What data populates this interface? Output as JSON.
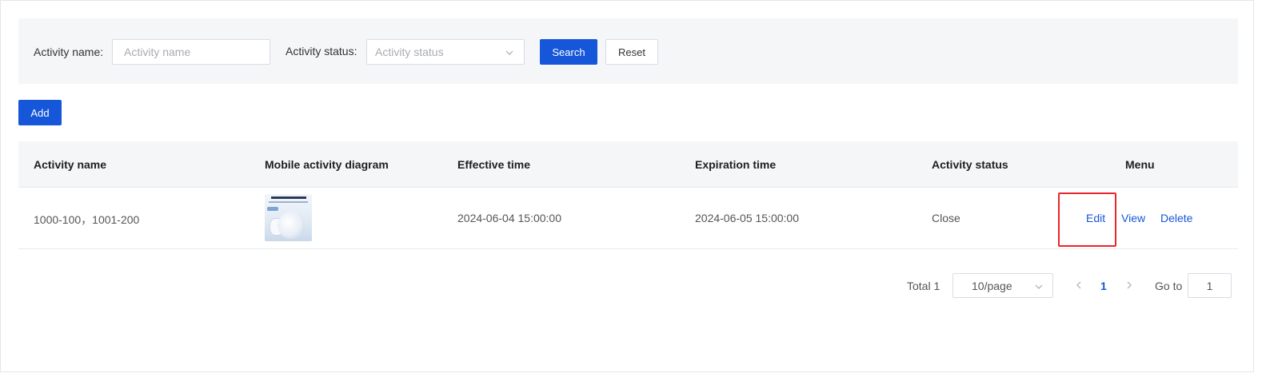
{
  "filters": {
    "name_label": "Activity name:",
    "name_placeholder": "Activity name",
    "status_label": "Activity status:",
    "status_placeholder": "Activity status",
    "search_label": "Search",
    "reset_label": "Reset"
  },
  "toolbar": {
    "add_label": "Add"
  },
  "table": {
    "headers": [
      "Activity name",
      "Mobile activity diagram",
      "Effective time",
      "Expiration time",
      "Activity status",
      "Menu"
    ],
    "rows": [
      {
        "activity_name": "1000-100，1001-200",
        "effective_time": "2024-06-04 15:00:00",
        "expiration_time": "2024-06-05 15:00:00",
        "status": "Close",
        "actions": [
          "Edit",
          "View",
          "Delete"
        ]
      }
    ]
  },
  "pagination": {
    "total": "Total 1",
    "page_size": "10/page",
    "current_page": "1",
    "goto_label": "Go to",
    "goto_value": "1"
  },
  "colors": {
    "primary": "#1656d9",
    "highlight": "#e8262a",
    "panel": "#f5f6f8"
  }
}
